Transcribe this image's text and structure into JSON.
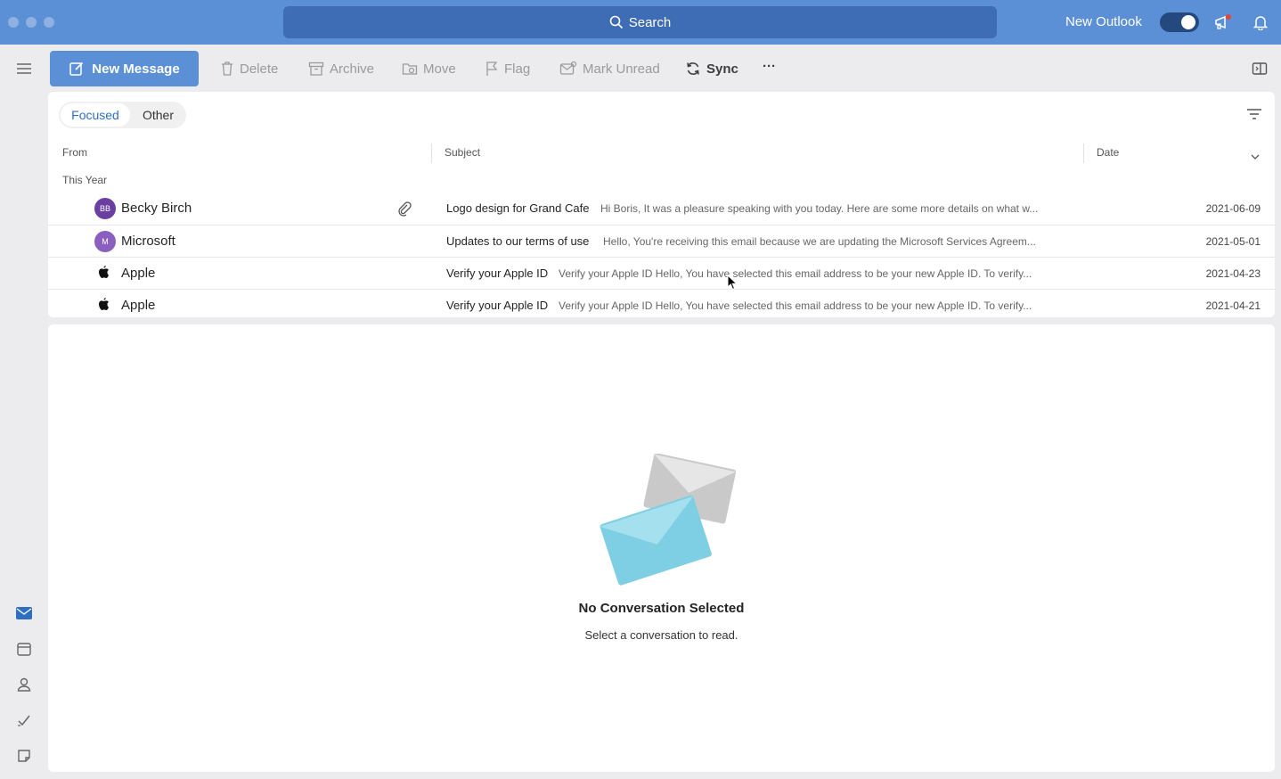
{
  "titlebar": {
    "search_label": "Search",
    "new_outlook_label": "New Outlook",
    "new_outlook_enabled": true
  },
  "toolbar": {
    "new_message": "New Message",
    "delete": "Delete",
    "archive": "Archive",
    "move": "Move",
    "flag": "Flag",
    "mark_unread": "Mark Unread",
    "sync": "Sync",
    "more": "···"
  },
  "list": {
    "tabs": {
      "focused": "Focused",
      "other": "Other"
    },
    "columns": {
      "from": "From",
      "subject": "Subject",
      "date": "Date"
    },
    "group": "This Year",
    "rows": [
      {
        "initials": "BB",
        "avatar_color": "#6b3fa0",
        "sender": "Becky Birch",
        "subject": "Logo design for Grand Cafe",
        "preview": "Hi Boris, It was a pleasure speaking with you today. Here are some more details on what w...",
        "date": "2021-06-09",
        "attachment": true
      },
      {
        "initials": "M",
        "avatar_color": "#8a5fbf",
        "sender": "Microsoft",
        "subject": "Updates to our terms of use",
        "preview": "Hello, You're receiving this email because we are updating the Microsoft Services Agreem...",
        "date": "2021-05-01"
      },
      {
        "sender": "Apple",
        "subject": "Verify your Apple ID",
        "preview": "Verify your Apple ID Hello, You have selected this email address to be your new Apple ID. To verify...",
        "date": "2021-04-23"
      },
      {
        "sender": "Apple",
        "subject": "Verify your Apple ID",
        "preview": "Verify your Apple ID Hello, You have selected this email address to be your new Apple ID. To verify...",
        "date": "2021-04-21"
      }
    ]
  },
  "reading": {
    "title": "No Conversation Selected",
    "subtitle": "Select a conversation to read."
  },
  "colors": {
    "accent": "#5b8fd6",
    "accent_dark": "#3f6db5"
  }
}
